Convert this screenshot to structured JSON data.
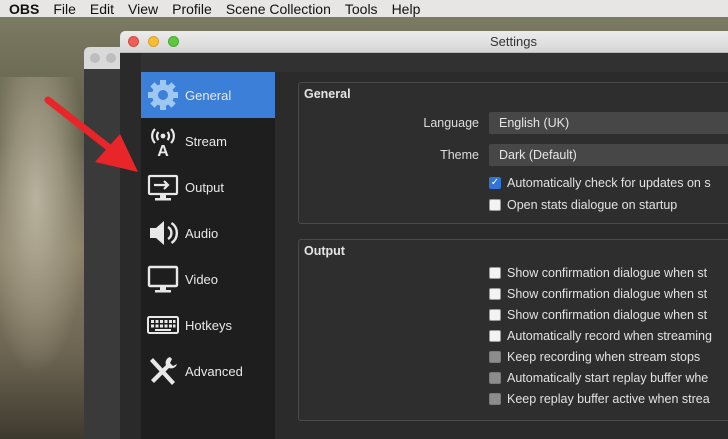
{
  "menubar": {
    "app": "OBS",
    "items": [
      "File",
      "Edit",
      "View",
      "Profile",
      "Scene Collection",
      "Tools",
      "Help"
    ]
  },
  "window": {
    "title": "Settings"
  },
  "sidebar": {
    "items": [
      {
        "label": "General",
        "icon": "gear-icon",
        "active": true
      },
      {
        "label": "Stream",
        "icon": "broadcast-icon",
        "active": false
      },
      {
        "label": "Output",
        "icon": "output-icon",
        "active": false
      },
      {
        "label": "Audio",
        "icon": "speaker-icon",
        "active": false
      },
      {
        "label": "Video",
        "icon": "monitor-icon",
        "active": false
      },
      {
        "label": "Hotkeys",
        "icon": "keyboard-icon",
        "active": false
      },
      {
        "label": "Advanced",
        "icon": "tools-icon",
        "active": false
      }
    ]
  },
  "general": {
    "title": "General",
    "language_label": "Language",
    "language_value": "English (UK)",
    "theme_label": "Theme",
    "theme_value": "Dark (Default)",
    "checkboxes": [
      {
        "label": "Automatically check for updates on s",
        "checked": true
      },
      {
        "label": "Open stats dialogue on startup",
        "checked": false
      }
    ]
  },
  "output": {
    "title": "Output",
    "checkboxes": [
      {
        "label": "Show confirmation dialogue when st",
        "checked": false,
        "disabled": false
      },
      {
        "label": "Show confirmation dialogue when st",
        "checked": false,
        "disabled": false
      },
      {
        "label": "Show confirmation dialogue when st",
        "checked": false,
        "disabled": false
      },
      {
        "label": "Automatically record when streaming",
        "checked": false,
        "disabled": false
      },
      {
        "label": "Keep recording when stream stops",
        "checked": false,
        "disabled": true
      },
      {
        "label": "Automatically start replay buffer whe",
        "checked": false,
        "disabled": true
      },
      {
        "label": "Keep replay buffer active when strea",
        "checked": false,
        "disabled": true
      }
    ]
  },
  "colors": {
    "accent": "#3c7fd8",
    "arrow": "#e8262a",
    "checkbox_checked": "#2f74d6"
  }
}
